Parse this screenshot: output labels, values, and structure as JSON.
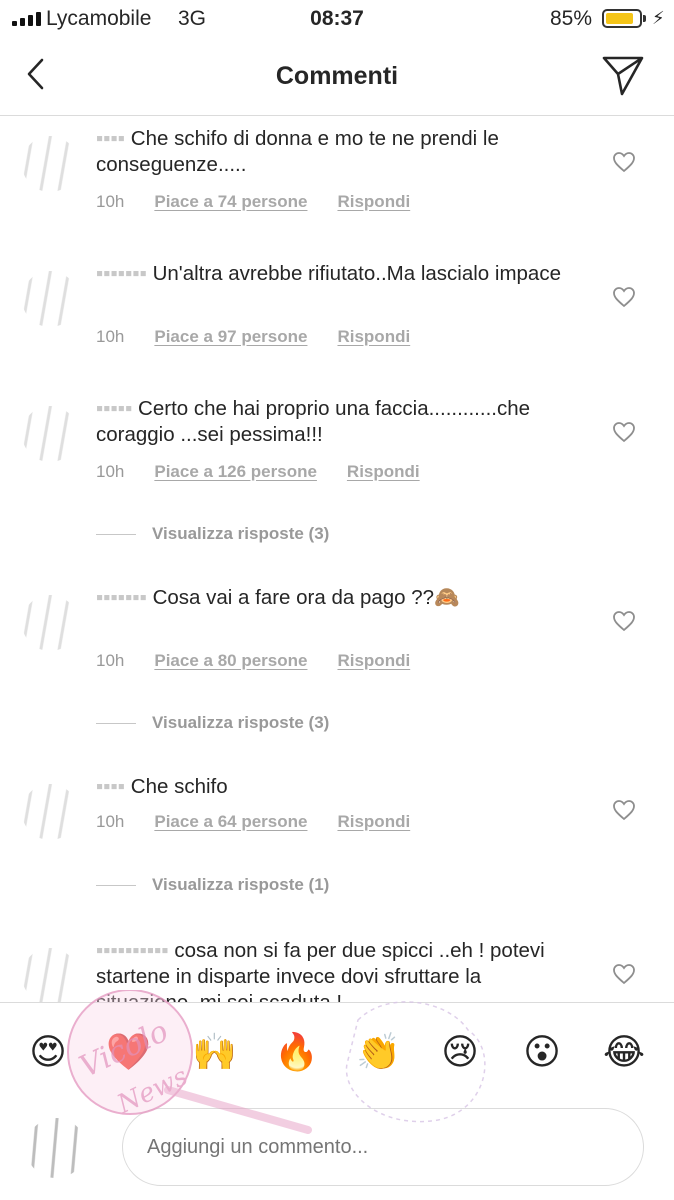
{
  "status": {
    "carrier": "Lycamobile",
    "network": "3G",
    "time": "08:37",
    "battery": "85%",
    "battery_level": 0.85,
    "battery_color": "#f5c518"
  },
  "header": {
    "title": "Commenti",
    "back_icon": "chevron-left-icon",
    "send_icon": "paper-plane-icon"
  },
  "comments": [
    {
      "text": "Che schifo di donna e mo te ne prendi le conseguenze.....",
      "time": "10h",
      "likes": "Piace a 74 persone",
      "reply": "Rispondi"
    },
    {
      "text": "Un'altra avrebbe rifiutato..Ma lascialo impace",
      "time": "10h",
      "likes": "Piace a 97 persone",
      "reply": "Rispondi"
    },
    {
      "text": "Certo che hai proprio una faccia............che coraggio ...sei pessima!!!",
      "time": "10h",
      "likes": "Piace a 126 persone",
      "reply": "Rispondi",
      "view_replies": "Visualizza risposte (3)"
    },
    {
      "text": "Cosa vai a fare ora da pago ??🙈",
      "time": "10h",
      "likes": "Piace a 80 persone",
      "reply": "Rispondi",
      "view_replies": "Visualizza risposte (3)"
    },
    {
      "text": "Che schifo",
      "time": "10h",
      "likes": "Piace a 64 persone",
      "reply": "Rispondi",
      "view_replies": "Visualizza risposte (1)"
    },
    {
      "text": "cosa non si fa per due spicci ..eh !  potevi startene in disparte invece dovi sfruttare la situazione, mi sei scaduta !"
    }
  ],
  "emoji_bar": [
    "😍",
    "❤️",
    "🙌",
    "🔥",
    "👏",
    "😢",
    "😮",
    "😂"
  ],
  "composer": {
    "placeholder": "Aggiungi un commento..."
  },
  "watermark": {
    "text": "Vicolo delle News"
  }
}
